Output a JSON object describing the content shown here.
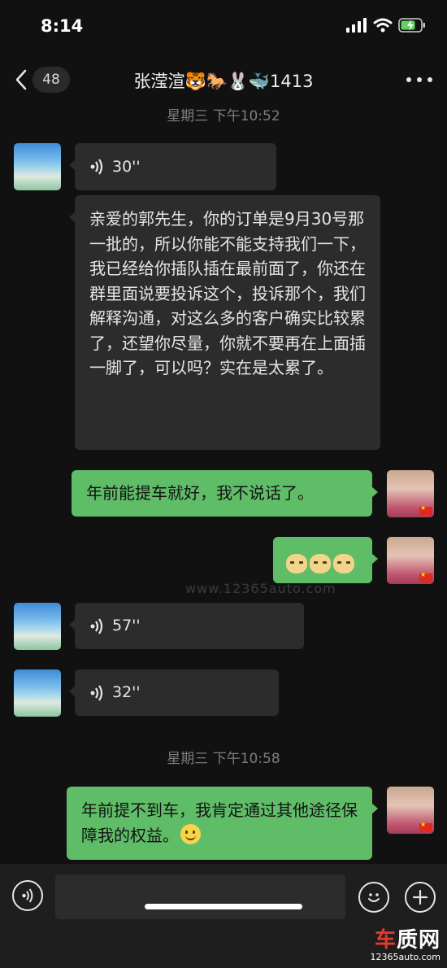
{
  "status_bar": {
    "time": "8:14"
  },
  "nav": {
    "unread_count": "48",
    "title": "张滢渲🐯🐎🐰🐳1413"
  },
  "timestamps": [
    "星期三 下午10:52",
    "星期三 下午10:58"
  ],
  "messages": {
    "m1": {
      "duration": "30''"
    },
    "m2": {
      "text": "亲爱的郭先生，你的订单是9月30号那一批的，所以你能不能支持我们一下，我已经给你插队插在最前面了，你还在群里面说要投诉这个，投诉那个，我们解释沟通，对这么多的客户确实比较累了，还望你尽量，你就不要再在上面插一脚了，可以吗？实在是太累了。"
    },
    "m3": {
      "text": "年前能提车就好，我不说话了。"
    },
    "m5": {
      "duration": "57''"
    },
    "m6": {
      "duration": "32''"
    },
    "m7": {
      "text": "年前提不到车，我肯定通过其他途径保障我的权益。"
    }
  },
  "watermark": {
    "brand_a": "车",
    "brand_b": "质网",
    "url": "12365auto.com",
    "faint": "www.12365auto.com"
  }
}
